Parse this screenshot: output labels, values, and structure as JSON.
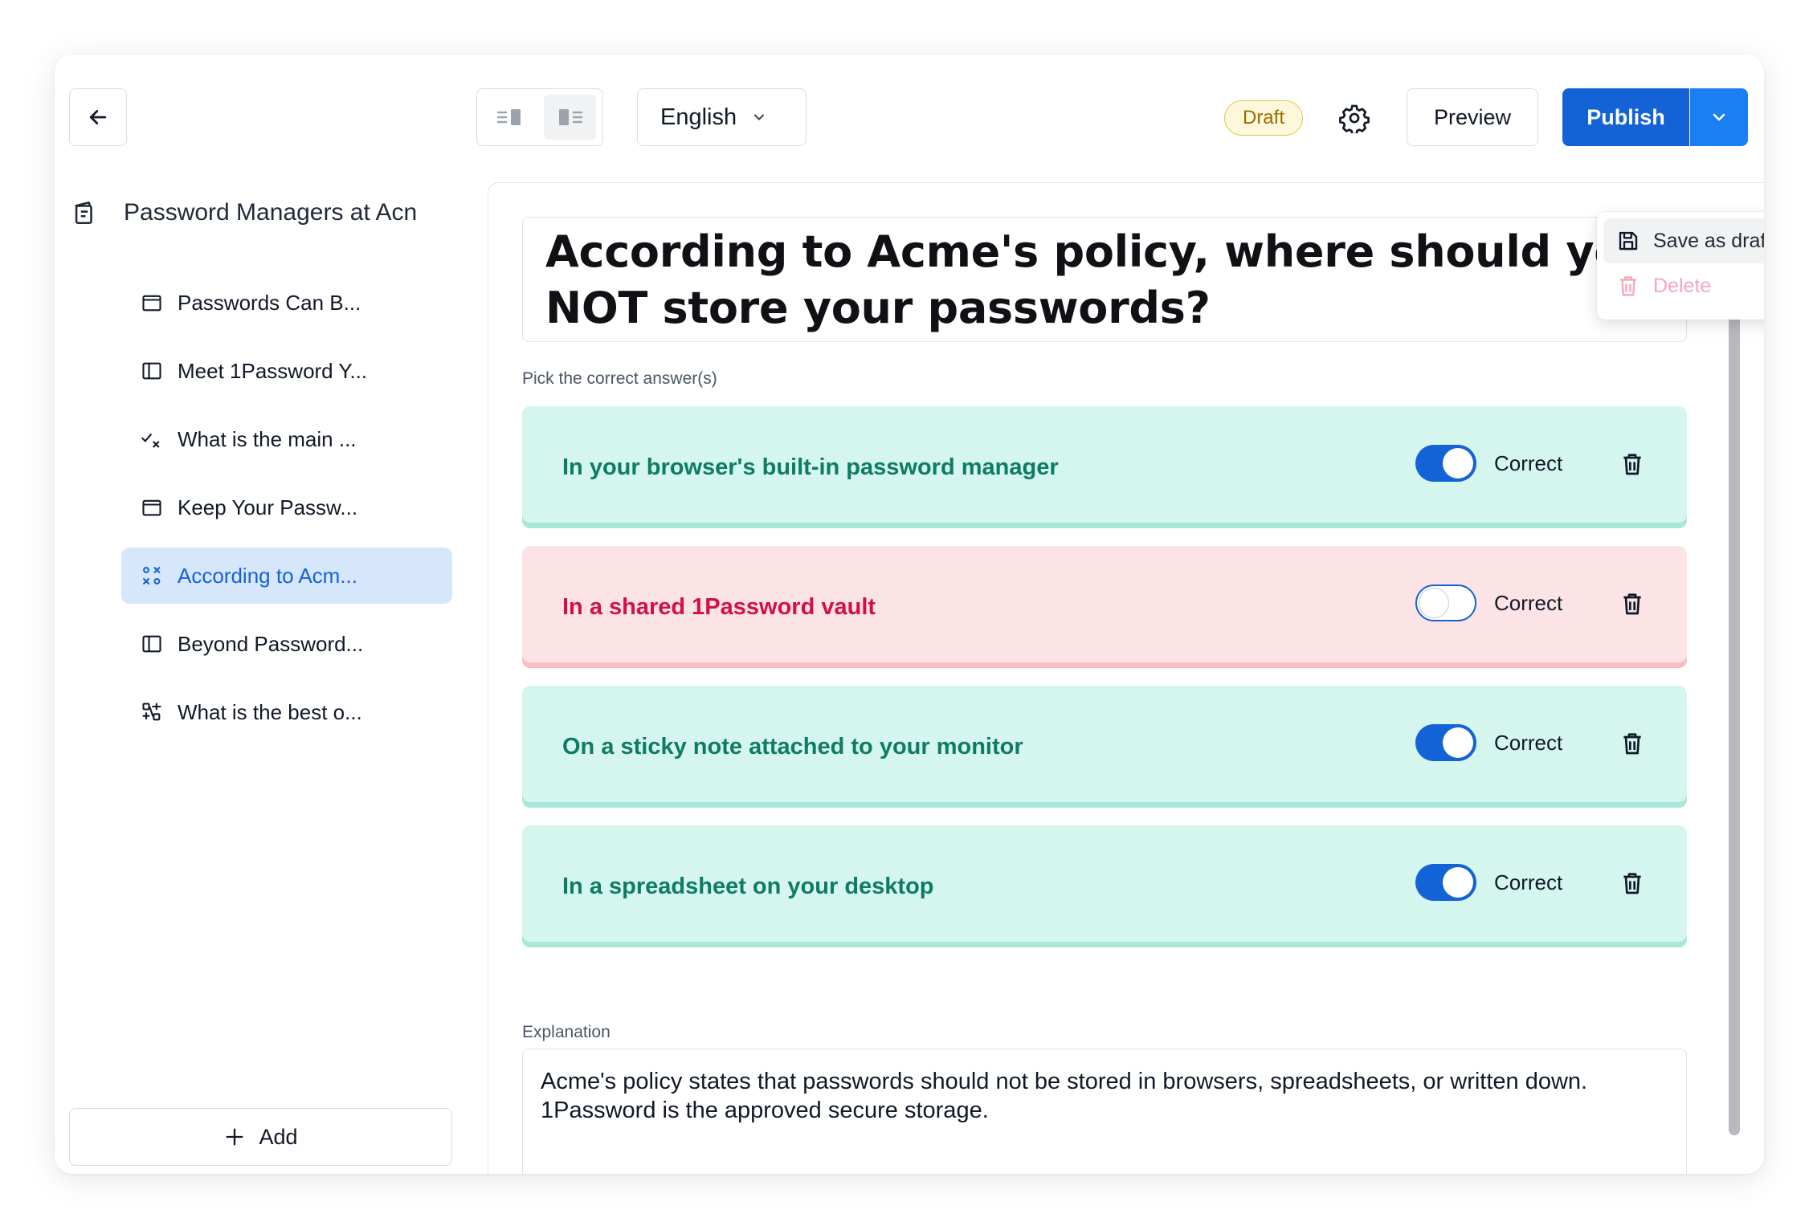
{
  "sidebar": {
    "course_title": "Password Managers at Acn",
    "items": [
      {
        "label": "Passwords Can B...",
        "icon": "page-icon",
        "active": false
      },
      {
        "label": "Meet 1Password Y...",
        "icon": "split-panel-icon",
        "active": false
      },
      {
        "label": "What is the main ...",
        "icon": "check-cross-icon",
        "active": false
      },
      {
        "label": "Keep Your Passw...",
        "icon": "page-icon",
        "active": false
      },
      {
        "label": "According to Acm...",
        "icon": "multi-choice-icon",
        "active": true
      },
      {
        "label": "Beyond Password...",
        "icon": "split-panel-icon",
        "active": false
      },
      {
        "label": "What is the best o...",
        "icon": "matching-icon",
        "active": false
      }
    ],
    "add_label": "Add"
  },
  "toolbar": {
    "language": "English",
    "status_badge": "Draft",
    "preview_label": "Preview",
    "publish_label": "Publish"
  },
  "menu": {
    "items": [
      {
        "label": "Save as draft",
        "icon": "save-icon"
      },
      {
        "label": "Delete",
        "icon": "trash-icon",
        "disabled": true
      }
    ]
  },
  "question": {
    "text": "According to Acme's policy, where should you NOT store your passwords?",
    "hint": "Pick the correct answer(s)",
    "answers": [
      {
        "text": "In your browser's built-in password manager",
        "correct": true,
        "toggle_label": "Correct"
      },
      {
        "text": "In a shared 1Password vault",
        "correct": false,
        "toggle_label": "Correct"
      },
      {
        "text": "On a sticky note attached to your monitor",
        "correct": true,
        "toggle_label": "Correct"
      },
      {
        "text": "In a spreadsheet on your desktop",
        "correct": true,
        "toggle_label": "Correct"
      }
    ],
    "explanation_label": "Explanation",
    "explanation": "Acme's policy states that passwords should not be stored in browsers, spreadsheets, or written down. 1Password is the approved secure storage."
  },
  "colors": {
    "accent": "#1463d6",
    "correct_bg": "#d5f6ef",
    "correct_text": "#0d7c63",
    "wrong_bg": "#fce3e6",
    "wrong_text": "#d1104b",
    "draft_badge": "#9a6c00"
  }
}
